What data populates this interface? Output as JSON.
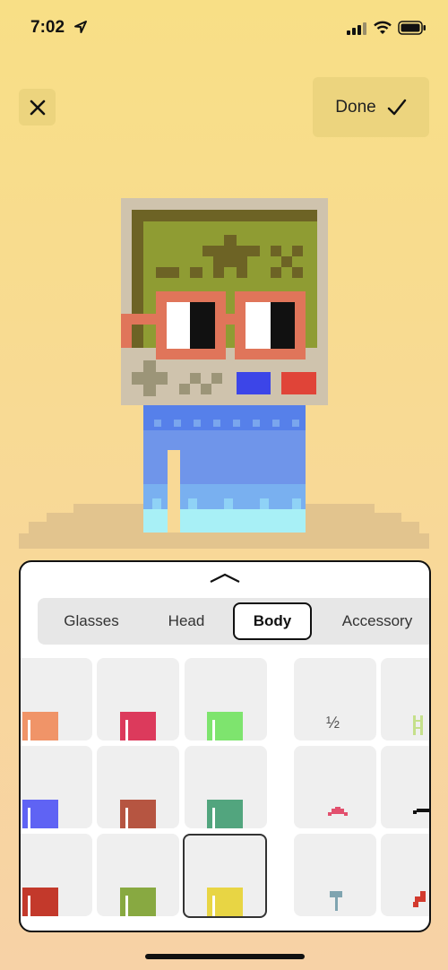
{
  "status": {
    "time": "7:02"
  },
  "header": {
    "done_label": "Done"
  },
  "tabs": [
    {
      "label": "Glasses",
      "active": false
    },
    {
      "label": "Head",
      "active": false
    },
    {
      "label": "Body",
      "active": true
    },
    {
      "label": "Accessory",
      "active": false
    }
  ],
  "body_colors": [
    "#f09468",
    "#dc3a5c",
    "#7ee46e",
    "#5f63f4",
    "#b65541",
    "#52a57e",
    "#c3392b",
    "#88a941",
    "#e8d544"
  ],
  "selected_body_color": "#e8d544",
  "accessory_tiles": [
    {
      "icon": "fraction-icon",
      "text": "½"
    },
    {
      "icon": "ladder-icon"
    },
    {
      "icon": "crab-icon"
    },
    {
      "icon": "mustache-icon"
    },
    {
      "icon": "flag-icon"
    },
    {
      "icon": "red-pixel-icon"
    }
  ]
}
